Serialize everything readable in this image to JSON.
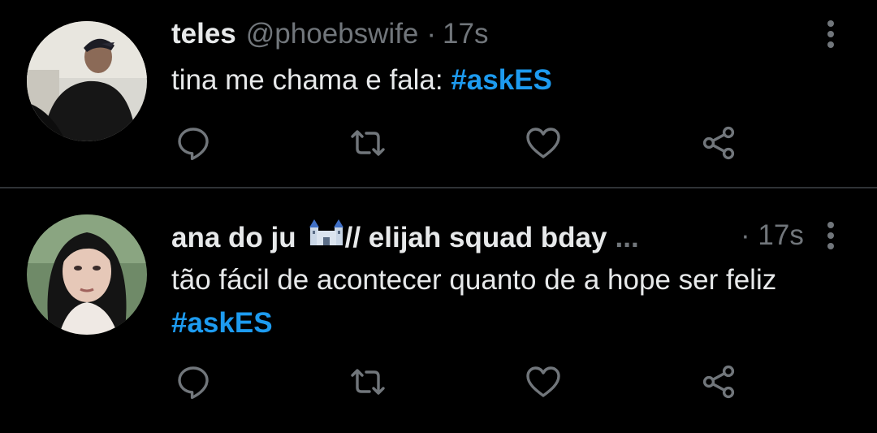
{
  "colors": {
    "background": "#000000",
    "text_primary": "#e7e9ea",
    "text_secondary": "#71767b",
    "hashtag": "#1d9bf0",
    "divider": "#2f3336"
  },
  "tweets": [
    {
      "display_name": "teles",
      "handle": "@phoebswife",
      "separator": "·",
      "time": "17s",
      "text": "tina me chama e fala: ",
      "hashtag": "#askES",
      "icons": [
        "reply-icon",
        "retweet-icon",
        "like-icon",
        "share-icon",
        "more-options-icon"
      ]
    },
    {
      "display_name_part1": "ana do ju",
      "display_name_part2": "// elijah squad bday",
      "emoji": "castle-emoji",
      "ellipsis": "...",
      "separator": "·",
      "time": "17s",
      "text": "tão fácil de acontecer quanto de a hope ser feliz ",
      "hashtag": "#askES",
      "icons": [
        "reply-icon",
        "retweet-icon",
        "like-icon",
        "share-icon",
        "more-options-icon"
      ]
    }
  ]
}
